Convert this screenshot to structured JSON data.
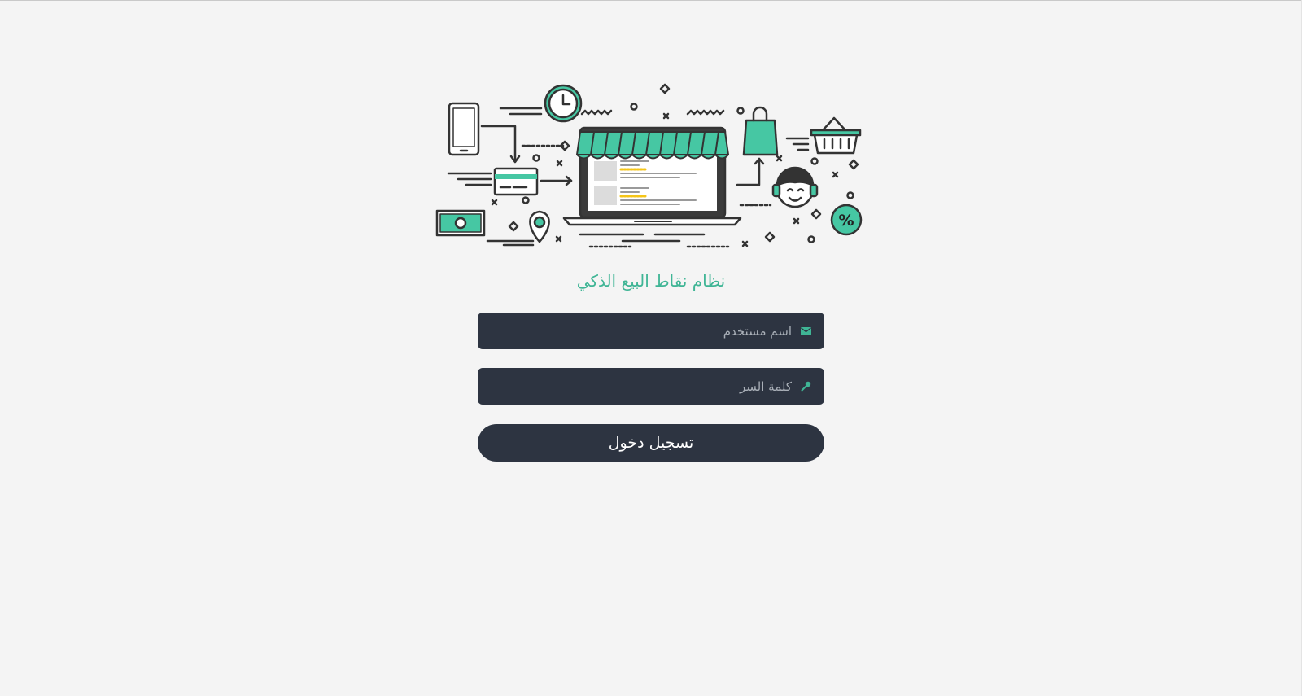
{
  "app": {
    "title": "نظام نقاط البيع الذكي"
  },
  "login_form": {
    "username": {
      "placeholder": "اسم مستخدم",
      "value": "",
      "icon": "envelope-icon"
    },
    "password": {
      "placeholder": "كلمة السر",
      "value": "",
      "icon": "key-icon"
    },
    "submit_label": "تسجيل دخول"
  },
  "illustration": {
    "icon": "online-store-illustration",
    "percent_badge": "%"
  },
  "colors": {
    "background": "#f4f4f4",
    "accent": "#3fb595",
    "input_background": "#2d3441",
    "illustration_stroke": "#333333",
    "illustration_fill": "#46c7a3",
    "star": "#f5c518"
  }
}
